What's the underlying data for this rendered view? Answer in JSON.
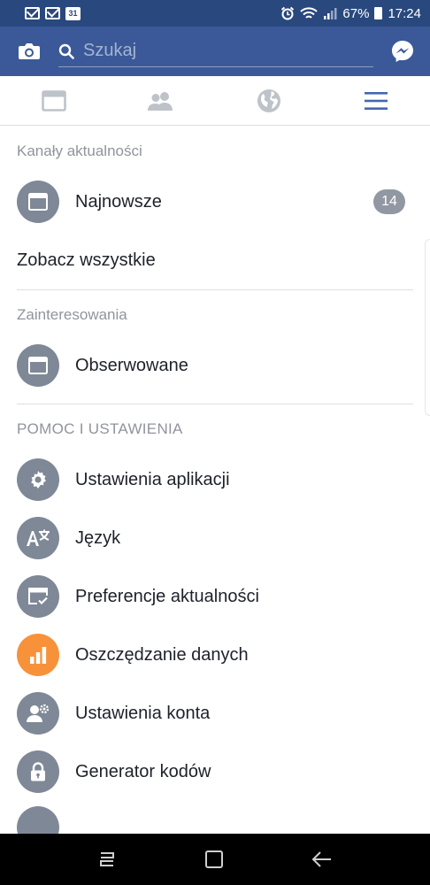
{
  "status_bar": {
    "calendar_day": "31",
    "battery": "67%",
    "time": "17:24"
  },
  "header": {
    "search_placeholder": "Szukaj",
    "icons": [
      "camera-icon",
      "search-icon",
      "messenger-icon"
    ]
  },
  "tabs": [
    {
      "name": "news-feed",
      "icon": "news-feed-icon"
    },
    {
      "name": "friends",
      "icon": "friends-icon"
    },
    {
      "name": "notifications",
      "icon": "globe-icon"
    },
    {
      "name": "menu",
      "icon": "hamburger-icon",
      "active": true
    }
  ],
  "menu": {
    "section_feeds": "Kanały aktualności",
    "latest": {
      "label": "Najnowsze",
      "badge": "14",
      "icon": "feed-icon"
    },
    "see_all": "Zobacz wszystkie",
    "section_interests": "Zainteresowania",
    "following": {
      "label": "Obserwowane",
      "icon": "feed-icon"
    },
    "section_help": "POMOC I USTAWIENIA",
    "help_items": [
      {
        "label": "Ustawienia aplikacji",
        "icon": "gear-icon"
      },
      {
        "label": "Język",
        "icon": "translate-icon"
      },
      {
        "label": "Preferencje aktualności",
        "icon": "feed-preferences-icon"
      },
      {
        "label": "Oszczędzanie danych",
        "icon": "bar-chart-icon",
        "color": "#f7923a"
      },
      {
        "label": "Ustawienia konta",
        "icon": "account-settings-icon"
      },
      {
        "label": "Generator kodów",
        "icon": "lock-icon"
      }
    ]
  },
  "colors": {
    "header_bg": "#3b5998",
    "status_bg": "#29487d",
    "tab_active": "#4267b2",
    "icon_gray": "#7f8896",
    "data_saver_orange": "#f7923a"
  }
}
